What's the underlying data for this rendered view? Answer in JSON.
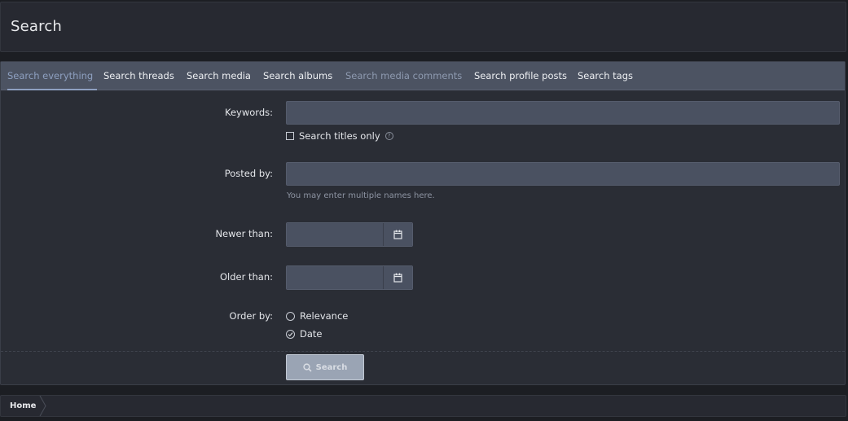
{
  "page": {
    "title": "Search"
  },
  "tabs": [
    {
      "label": "Search everything",
      "state": "active"
    },
    {
      "label": "Search threads"
    },
    {
      "label": "Search media"
    },
    {
      "label": "Search albums"
    },
    {
      "label": "Search media comments",
      "state": "muted"
    },
    {
      "label": "Search profile posts"
    },
    {
      "label": "Search tags"
    }
  ],
  "form": {
    "keywords_label": "Keywords:",
    "keywords_value": "",
    "titles_only_label": "Search titles only",
    "titles_only_checked": false,
    "posted_by_label": "Posted by:",
    "posted_by_value": "",
    "posted_by_hint": "You may enter multiple names here.",
    "newer_than_label": "Newer than:",
    "newer_than_value": "",
    "older_than_label": "Older than:",
    "older_than_value": "",
    "order_by_label": "Order by:",
    "order_options": [
      {
        "label": "Relevance",
        "selected": false
      },
      {
        "label": "Date",
        "selected": true
      }
    ],
    "submit_label": "Search"
  },
  "breadcrumb": {
    "home_label": "Home"
  },
  "icons": {
    "calendar": "calendar-icon",
    "help": "help-icon",
    "search": "search-icon"
  },
  "colors": {
    "active_tab": "#8ea0c0",
    "tab_bar": "#4c5362",
    "input_bg": "#4a5161",
    "button_bg": "#9aa4b4"
  }
}
